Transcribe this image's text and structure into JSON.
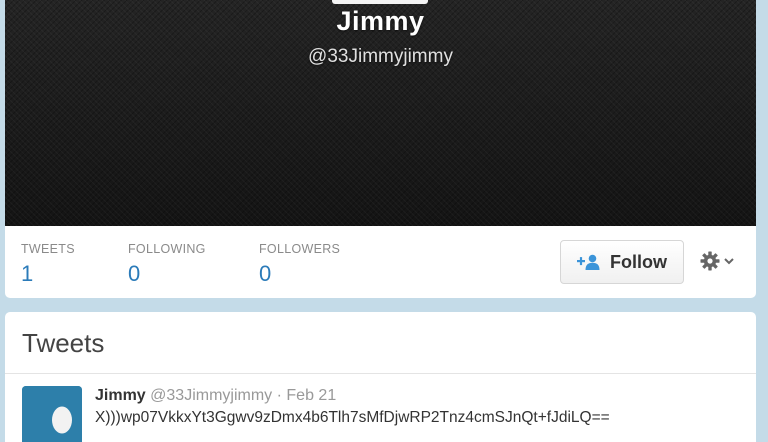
{
  "profile": {
    "name": "Jimmy",
    "screen_name": "@33Jimmyjimmy"
  },
  "stats": [
    {
      "label": "TWEETS",
      "value": "1"
    },
    {
      "label": "FOLLOWING",
      "value": "0"
    },
    {
      "label": "FOLLOWERS",
      "value": "0"
    }
  ],
  "actions": {
    "follow_label": "Follow",
    "follow_icon": "add-user-icon",
    "settings_icon": "gear-icon",
    "settings_dropdown_icon": "chevron-down-icon"
  },
  "timeline": {
    "title": "Tweets",
    "tweets": [
      {
        "name": "Jimmy",
        "handle": "@33Jimmyjimmy",
        "separator": "·",
        "date": "Feb 21",
        "text": "X)))wp07VkkxYt3Ggwv9zDmx4b6Tlh7sMfDjwRP2Tnz4cmSJnQt+fJdiLQ=="
      }
    ]
  },
  "colors": {
    "page_background": "#c4dbe8",
    "header_background": "#1d1d1d",
    "stat_value": "#2b7bb9",
    "stat_label": "#8a8a8a",
    "follow_icon": "#3b94d9",
    "avatar_background": "#2d7faa"
  }
}
